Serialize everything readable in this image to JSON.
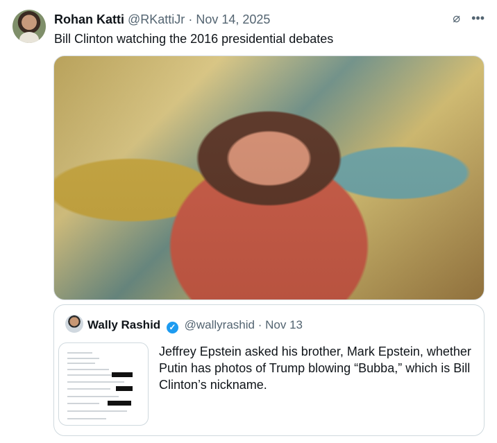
{
  "tweet": {
    "author_name": "Rohan Katti",
    "author_handle": "@RKattiJr",
    "date": "Nov 14, 2025",
    "text": "Bill Clinton watching the 2016 presidential debates"
  },
  "icons": {
    "grok": "grok-icon",
    "more": "more-icon",
    "verified": "verified-badge"
  },
  "quote": {
    "author_name": "Wally Rashid",
    "author_handle": "@wallyrashid",
    "date": "Nov 13",
    "text": "Jeffrey Epstein asked his brother, Mark Epstein, whether Putin has photos of Trump blowing “Bubba,” which is Bill Clinton’s nickname."
  },
  "colors": {
    "text": "#0f1419",
    "muted": "#536471",
    "border": "#cfd9de",
    "verified": "#1d9bf0"
  }
}
